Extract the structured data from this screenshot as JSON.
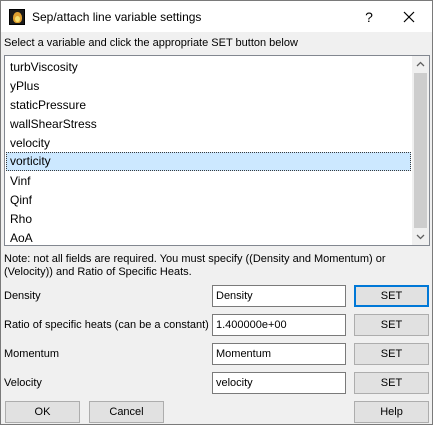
{
  "window": {
    "title": "Sep/attach line variable settings",
    "help_glyph": "?",
    "close_glyph": "✕"
  },
  "instruction": "Select a variable and click the appropriate SET button below",
  "variables": {
    "items": [
      "turbViscosity",
      "yPlus",
      "staticPressure",
      "wallShearStress",
      "velocity",
      "vorticity",
      "Vinf",
      "Qinf",
      "Rho",
      "AoA"
    ],
    "selected": "vorticity"
  },
  "note": "Note: not all fields are required.  You must specify ((Density and Momentum)  or (Velocity))  and Ratio of Specific Heats.",
  "fields": [
    {
      "label": "Density",
      "value": "Density",
      "set_label": "SET"
    },
    {
      "label": "Ratio of specific heats (can be a constant)",
      "value": "1.400000e+00",
      "set_label": "SET"
    },
    {
      "label": "Momentum",
      "value": "Momentum",
      "set_label": "SET"
    },
    {
      "label": "Velocity",
      "value": "velocity",
      "set_label": "SET"
    }
  ],
  "buttons": {
    "ok": "OK",
    "cancel": "Cancel",
    "help": "Help"
  }
}
